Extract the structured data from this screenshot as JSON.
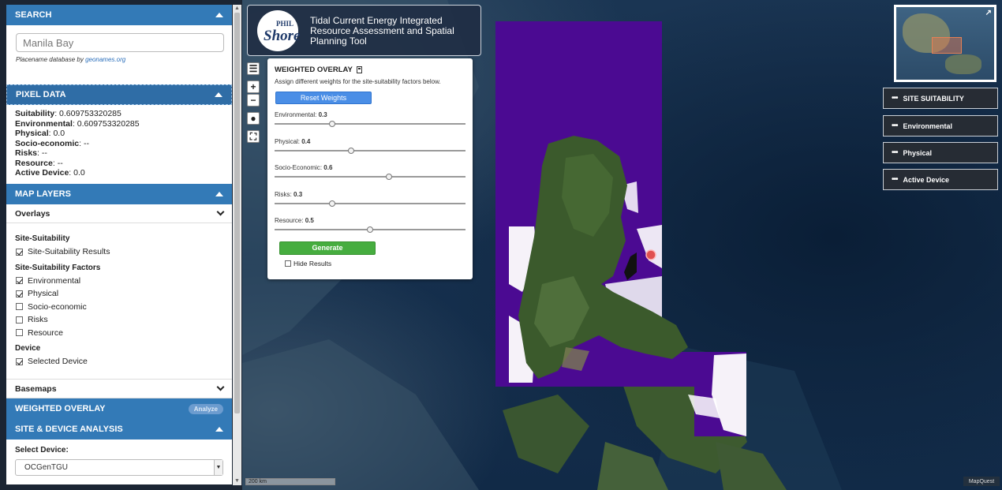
{
  "search": {
    "header": "Search",
    "value": "Manila Bay",
    "note_prefix": "Placename database by ",
    "note_link": "geonames.org"
  },
  "pixel_data": {
    "header": "Pixel Data",
    "rows": [
      {
        "label": "Suitability",
        "value": "0.609753320285"
      },
      {
        "label": "Environmental",
        "value": "0.609753320285"
      },
      {
        "label": "Physical",
        "value": "0.0"
      },
      {
        "label": "Socio-economic",
        "value": "--"
      },
      {
        "label": "Risks",
        "value": "--"
      },
      {
        "label": "Resource",
        "value": "--"
      },
      {
        "label": "Active Device",
        "value": "0.0"
      }
    ]
  },
  "map_layers": {
    "header": "Map Layers",
    "overlays_label": "Overlays",
    "groups": [
      {
        "title": "Site-Suitability",
        "items": [
          {
            "label": "Site-Suitability Results",
            "checked": true
          }
        ]
      },
      {
        "title": "Site-Suitability Factors",
        "items": [
          {
            "label": "Environmental",
            "checked": true
          },
          {
            "label": "Physical",
            "checked": true
          },
          {
            "label": "Socio-economic",
            "checked": false
          },
          {
            "label": "Risks",
            "checked": false
          },
          {
            "label": "Resource",
            "checked": false
          }
        ]
      },
      {
        "title": "Device",
        "items": [
          {
            "label": "Selected Device",
            "checked": true
          }
        ]
      }
    ],
    "basemaps_label": "Basemaps"
  },
  "weighted_overlay": {
    "header": "Weighted Overlay",
    "badge": "Analyze"
  },
  "site_device": {
    "header": "Site & Device Analysis",
    "select_label": "Select Device:",
    "selected": "OCGenTGU"
  },
  "app": {
    "logo_top": "PHIL",
    "logo_main": "Shore",
    "title": "Tidal Current Energy Integrated Resource Assessment and Spatial Planning Tool"
  },
  "map_controls": {
    "menu": "☰",
    "zoom_in": "+",
    "zoom_out": "−",
    "globe": "●",
    "fullscreen": "⛶"
  },
  "overlay_panel": {
    "title": "WEIGHTED OVERLAY",
    "description": "Assign different weights for the site-suitability factors below.",
    "reset_label": "Reset Weights",
    "sliders": [
      {
        "label": "Environmental",
        "value": 0.3
      },
      {
        "label": "Physical",
        "value": 0.4
      },
      {
        "label": "Socio-Economic",
        "value": 0.6
      },
      {
        "label": "Risks",
        "value": 0.3
      },
      {
        "label": "Resource",
        "value": 0.5
      }
    ],
    "generate_label": "Generate",
    "hide_label": "Hide Results"
  },
  "legend_buttons": [
    "SITE SUITABILITY",
    "Environmental",
    "Physical",
    "Active Device"
  ],
  "scale": "200 km",
  "attribution": "MapQuest",
  "colors": {
    "panel_header": "#337ab7",
    "suitability_overlay": "#4b0a92",
    "generate": "#46ad3f",
    "reset": "#4a8ee6"
  }
}
